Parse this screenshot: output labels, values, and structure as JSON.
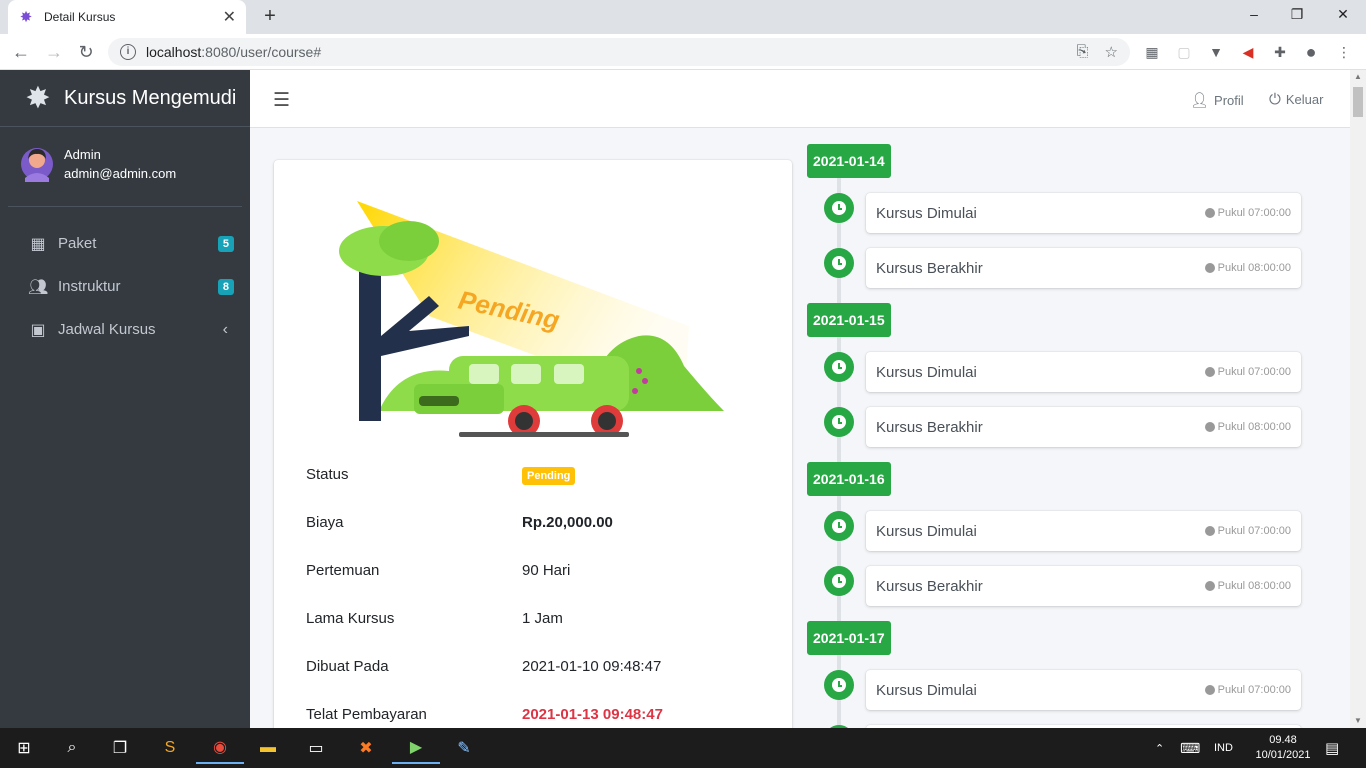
{
  "browser": {
    "tab_title": "Detail Kursus",
    "url_host": "localhost",
    "url_path": ":8080/user/course#"
  },
  "sidebar": {
    "brand": "Kursus Mengemudi",
    "user_name": "Admin",
    "user_email": "admin@admin.com",
    "items": [
      {
        "label": "Paket",
        "badge": "5",
        "icon": "grid-icon"
      },
      {
        "label": "Instruktur",
        "badge": "8",
        "icon": "users-icon"
      },
      {
        "label": "Jadwal Kursus",
        "icon": "calendar-icon"
      }
    ]
  },
  "topnav": {
    "profile_label": "Profil",
    "logout_label": "Keluar"
  },
  "course": {
    "illustration_text": "Pending",
    "rows": [
      {
        "label": "Status",
        "value": "Pending"
      },
      {
        "label": "Biaya",
        "value": "Rp.20,000.00"
      },
      {
        "label": "Pertemuan",
        "value": "90 Hari"
      },
      {
        "label": "Lama Kursus",
        "value": "1 Jam"
      },
      {
        "label": "Dibuat Pada",
        "value": "2021-01-10 09:48:47"
      },
      {
        "label": "Telat Pembayaran",
        "value": "2021-01-13 09:48:47"
      }
    ]
  },
  "timeline": {
    "days": [
      {
        "date": "2021-01-14",
        "events": [
          {
            "title": "Kursus Dimulai",
            "time": "Pukul 07:00:00"
          },
          {
            "title": "Kursus Berakhir",
            "time": "Pukul 08:00:00"
          }
        ]
      },
      {
        "date": "2021-01-15",
        "events": [
          {
            "title": "Kursus Dimulai",
            "time": "Pukul 07:00:00"
          },
          {
            "title": "Kursus Berakhir",
            "time": "Pukul 08:00:00"
          }
        ]
      },
      {
        "date": "2021-01-16",
        "events": [
          {
            "title": "Kursus Dimulai",
            "time": "Pukul 07:00:00"
          },
          {
            "title": "Kursus Berakhir",
            "time": "Pukul 08:00:00"
          }
        ]
      },
      {
        "date": "2021-01-17",
        "events": [
          {
            "title": "Kursus Dimulai",
            "time": "Pukul 07:00:00"
          }
        ]
      }
    ]
  },
  "taskbar": {
    "language": "IND",
    "time": "09.48",
    "date": "10/01/2021"
  },
  "colors": {
    "accent_green": "#28a745",
    "sidebar_bg": "#343a40",
    "badge_info": "#17a2b8",
    "badge_warning": "#ffc107",
    "danger": "#dc3545"
  }
}
